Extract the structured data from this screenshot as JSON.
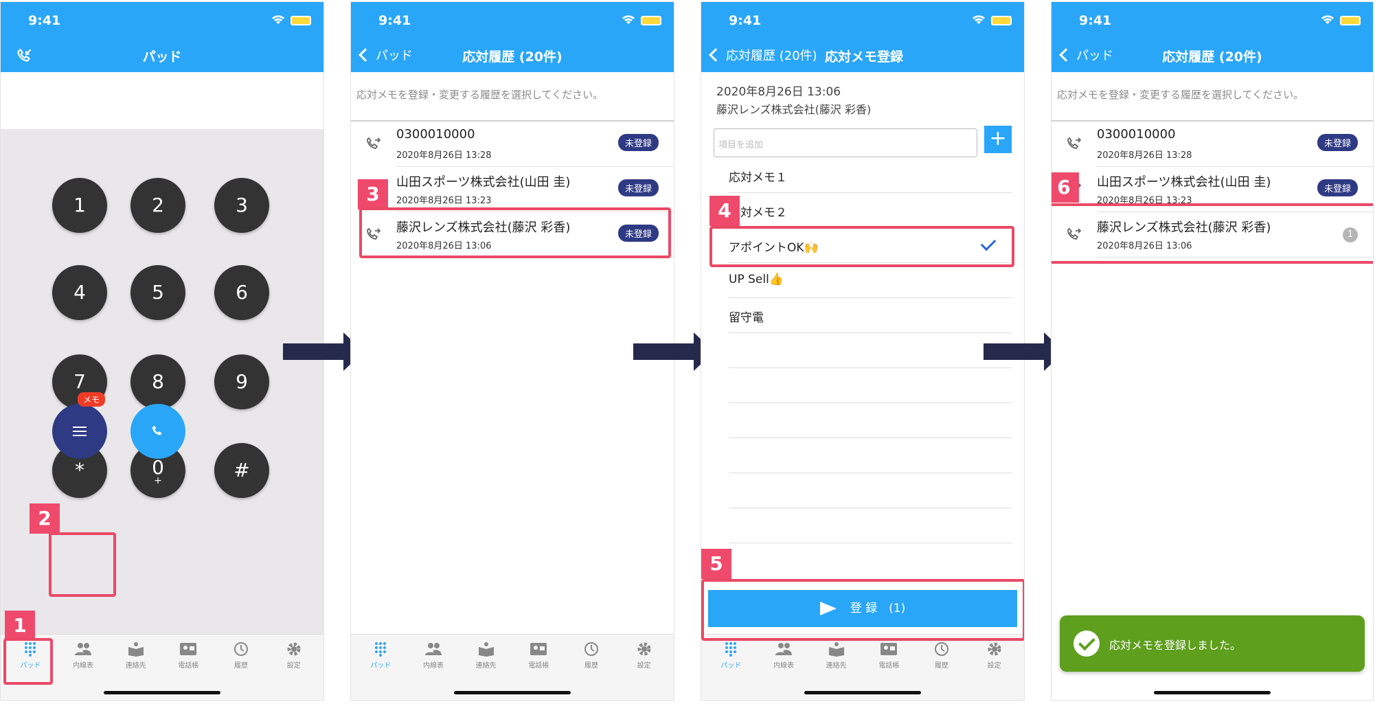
{
  "status": {
    "time": "9:41"
  },
  "screen1": {
    "title": "パッド",
    "keys": [
      {
        "label": "1",
        "sub": ""
      },
      {
        "label": "2",
        "sub": ""
      },
      {
        "label": "3",
        "sub": ""
      },
      {
        "label": "4",
        "sub": ""
      },
      {
        "label": "5",
        "sub": ""
      },
      {
        "label": "6",
        "sub": ""
      },
      {
        "label": "7",
        "sub": ""
      },
      {
        "label": "8",
        "sub": ""
      },
      {
        "label": "9",
        "sub": ""
      },
      {
        "label": "*",
        "sub": ""
      },
      {
        "label": "0",
        "sub": "+"
      },
      {
        "label": "#",
        "sub": ""
      }
    ],
    "memo_badge": "メモ"
  },
  "tabs": [
    {
      "label": "パッド",
      "icon": "keypad-icon"
    },
    {
      "label": "内線表",
      "icon": "people-icon"
    },
    {
      "label": "連絡先",
      "icon": "contacts-book-icon"
    },
    {
      "label": "電話帳",
      "icon": "phonebook-card-icon"
    },
    {
      "label": "履歴",
      "icon": "clock-icon"
    },
    {
      "label": "設定",
      "icon": "gear-icon"
    }
  ],
  "history": {
    "back": "パッド",
    "title": "応対履歴 (20件)",
    "hint": "応対メモを登録・変更する履歴を選択してください。",
    "rows": [
      {
        "name": "0300010000",
        "date": "2020年8月26日 13:28",
        "badge": "未登録"
      },
      {
        "name": "山田スポーツ株式会社(山田 圭)",
        "date": "2020年8月26日 13:23",
        "badge": "未登録"
      },
      {
        "name": "藤沢レンズ株式会社(藤沢 彩香)",
        "date": "2020年8月26日 13:06",
        "badge": "未登録"
      }
    ],
    "registered_count": "1"
  },
  "memo": {
    "back": "応対履歴 (20件)",
    "title": "応対メモ登録",
    "date": "2020年8月26日 13:06",
    "who": "藤沢レンズ株式会社(藤沢 彩香)",
    "add_placeholder": "項目を追加",
    "add_button": "+",
    "items": [
      "応対メモ１",
      "応対メモ２",
      "アポイントOK🙌",
      "UP Sell👍",
      "留守電"
    ],
    "selected_index": 2,
    "submit": "登 録　(1)"
  },
  "toast": "応対メモを登録しました。",
  "steps": [
    "1",
    "2",
    "3",
    "4",
    "5",
    "6"
  ],
  "colors": {
    "header": "#2aa6f8",
    "accent_navy": "#2f3a84",
    "highlight": "#ea4966",
    "toast": "#5e9f1e"
  }
}
